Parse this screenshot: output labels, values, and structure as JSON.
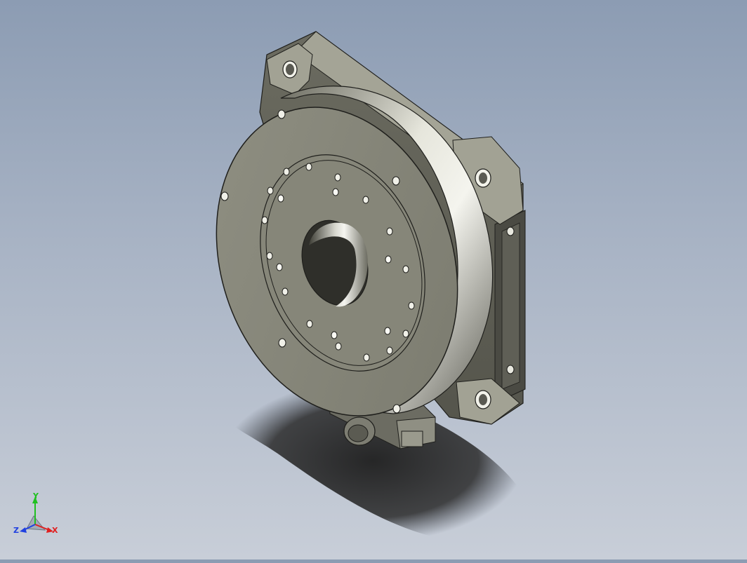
{
  "viewport": {
    "background_top": "#8c9cb3",
    "background_bottom": "#c8ced8",
    "model_color": "#8a8a7c",
    "shadow_color": "#2a2a2a"
  },
  "triad": {
    "x_label": "X",
    "y_label": "Y",
    "z_label": "Z",
    "x_color": "#e02020",
    "y_color": "#20c020",
    "z_color": "#2040e0"
  }
}
